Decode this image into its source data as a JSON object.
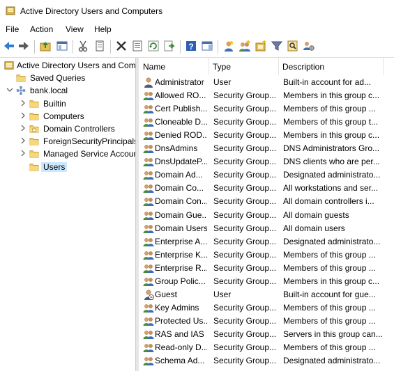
{
  "window": {
    "title": "Active Directory Users and Computers"
  },
  "menu": [
    "File",
    "Action",
    "View",
    "Help"
  ],
  "toolbar_icons": [
    "back-arrow-icon",
    "forward-arrow-icon",
    "up-folder-icon",
    "show-console-tree-icon",
    "cut-icon",
    "copy-icon",
    "delete-icon",
    "properties-icon",
    "refresh-icon",
    "export-list-icon",
    "help-icon",
    "action-pane-icon",
    "new-user-icon",
    "new-group-icon",
    "new-ou-icon",
    "filter-icon",
    "find-icon",
    "delegate-control-icon"
  ],
  "tree": {
    "root": "Active Directory Users and Com",
    "items": [
      {
        "label": "Saved Queries",
        "level": 1,
        "expander": "none",
        "icon": "folder"
      },
      {
        "label": "bank.local",
        "level": 1,
        "expander": "down",
        "icon": "domain"
      },
      {
        "label": "Builtin",
        "level": 2,
        "expander": "right",
        "icon": "folder"
      },
      {
        "label": "Computers",
        "level": 2,
        "expander": "right",
        "icon": "folder"
      },
      {
        "label": "Domain Controllers",
        "level": 2,
        "expander": "right",
        "icon": "ou"
      },
      {
        "label": "ForeignSecurityPrincipals",
        "level": 2,
        "expander": "right",
        "icon": "folder"
      },
      {
        "label": "Managed Service Accoun",
        "level": 2,
        "expander": "right",
        "icon": "folder"
      },
      {
        "label": "Users",
        "level": 2,
        "expander": "none",
        "icon": "folder",
        "selected": true
      }
    ]
  },
  "list": {
    "columns": [
      "Name",
      "Type",
      "Description"
    ],
    "rows": [
      {
        "name": "Administrator",
        "type": "User",
        "desc": "Built-in account for ad...",
        "kind": "user"
      },
      {
        "name": "Allowed RO...",
        "type": "Security Group...",
        "desc": "Members in this group c...",
        "kind": "group"
      },
      {
        "name": "Cert Publish...",
        "type": "Security Group...",
        "desc": "Members of this group ...",
        "kind": "group"
      },
      {
        "name": "Cloneable D...",
        "type": "Security Group...",
        "desc": "Members of this group t...",
        "kind": "group"
      },
      {
        "name": "Denied ROD...",
        "type": "Security Group...",
        "desc": "Members in this group c...",
        "kind": "group"
      },
      {
        "name": "DnsAdmins",
        "type": "Security Group...",
        "desc": "DNS Administrators Gro...",
        "kind": "group"
      },
      {
        "name": "DnsUpdateP...",
        "type": "Security Group...",
        "desc": "DNS clients who are per...",
        "kind": "group"
      },
      {
        "name": "Domain Ad...",
        "type": "Security Group...",
        "desc": "Designated administrato...",
        "kind": "group"
      },
      {
        "name": "Domain Co...",
        "type": "Security Group...",
        "desc": "All workstations and ser...",
        "kind": "group"
      },
      {
        "name": "Domain Con...",
        "type": "Security Group...",
        "desc": "All domain controllers i...",
        "kind": "group"
      },
      {
        "name": "Domain Gue...",
        "type": "Security Group...",
        "desc": "All domain guests",
        "kind": "group"
      },
      {
        "name": "Domain Users",
        "type": "Security Group...",
        "desc": "All domain users",
        "kind": "group"
      },
      {
        "name": "Enterprise A...",
        "type": "Security Group...",
        "desc": "Designated administrato...",
        "kind": "group"
      },
      {
        "name": "Enterprise K...",
        "type": "Security Group...",
        "desc": "Members of this group ...",
        "kind": "group"
      },
      {
        "name": "Enterprise R...",
        "type": "Security Group...",
        "desc": "Members of this group ...",
        "kind": "group"
      },
      {
        "name": "Group Polic...",
        "type": "Security Group...",
        "desc": "Members in this group c...",
        "kind": "group"
      },
      {
        "name": "Guest",
        "type": "User",
        "desc": "Built-in account for gue...",
        "kind": "user-disabled"
      },
      {
        "name": "Key Admins",
        "type": "Security Group...",
        "desc": "Members of this group ...",
        "kind": "group"
      },
      {
        "name": "Protected Us...",
        "type": "Security Group...",
        "desc": "Members of this group ...",
        "kind": "group"
      },
      {
        "name": "RAS and IAS ...",
        "type": "Security Group...",
        "desc": "Servers in this group can...",
        "kind": "group"
      },
      {
        "name": "Read-only D...",
        "type": "Security Group...",
        "desc": "Members of this group ...",
        "kind": "group"
      },
      {
        "name": "Schema Ad...",
        "type": "Security Group...",
        "desc": "Designated administrato...",
        "kind": "group"
      }
    ]
  }
}
